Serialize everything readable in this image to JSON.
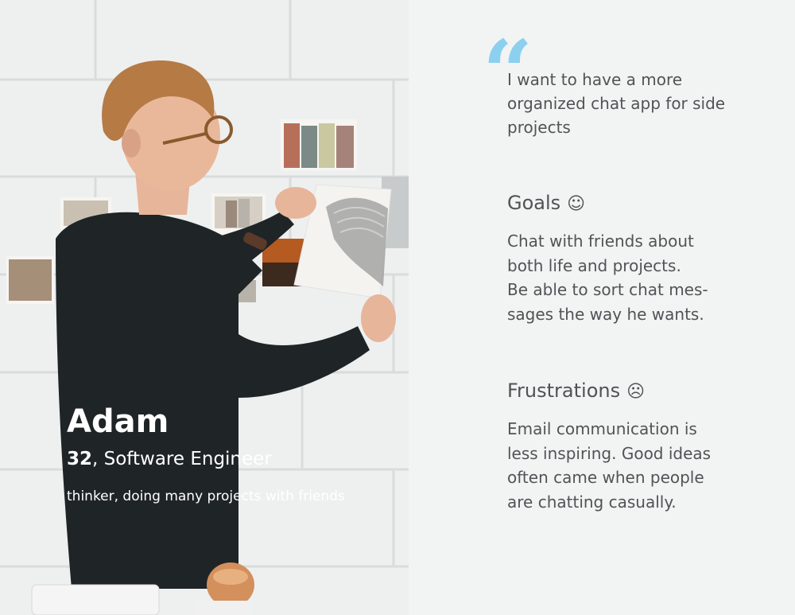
{
  "persona": {
    "name": "Adam",
    "age": "32",
    "occupation": ", Software Engineer",
    "bio": "thinker, doing many projects with friends"
  },
  "quote": {
    "mark": "“",
    "text": "I want to have a more organized chat app for side projects"
  },
  "goals": {
    "title": "Goals",
    "emoji": "☺",
    "text": "Chat with friends about\nboth life and projects.\nBe able to sort chat mes-\nsages the way he wants."
  },
  "frustrations": {
    "title": "Frustrations",
    "emoji": "☹",
    "text": "Email communication is\nless inspiring. Good ideas\noften came when people\nare chatting casually."
  },
  "colors": {
    "background": "#f2f3f3",
    "text": "#505456",
    "quote_accent": "#8bd0ef",
    "overlay_text": "#ffffff"
  }
}
